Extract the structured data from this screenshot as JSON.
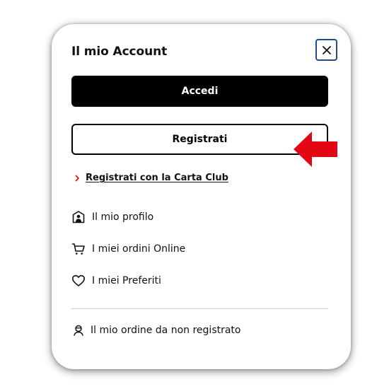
{
  "account_panel": {
    "title": "Il mio Account",
    "close_icon": "close-icon",
    "login_label": "Accedi",
    "register_label": "Registrati",
    "club_link": {
      "icon": "chevron-right-icon",
      "label": "Registrati con la Carta Club"
    },
    "menu": [
      {
        "icon": "profile-icon",
        "label": "Il mio profilo"
      },
      {
        "icon": "cart-icon",
        "label": "I miei ordini Online"
      },
      {
        "icon": "heart-icon",
        "label": "I miei Preferiti"
      }
    ],
    "guest_order": {
      "icon": "guest-icon",
      "label": "Il mio ordine da non registrato"
    }
  },
  "annotation": {
    "icon": "arrow-left-icon",
    "color": "#e30613"
  },
  "colors": {
    "close_border": "#1e4d87",
    "chevron": "#e30613",
    "primary_button": "#000000"
  }
}
